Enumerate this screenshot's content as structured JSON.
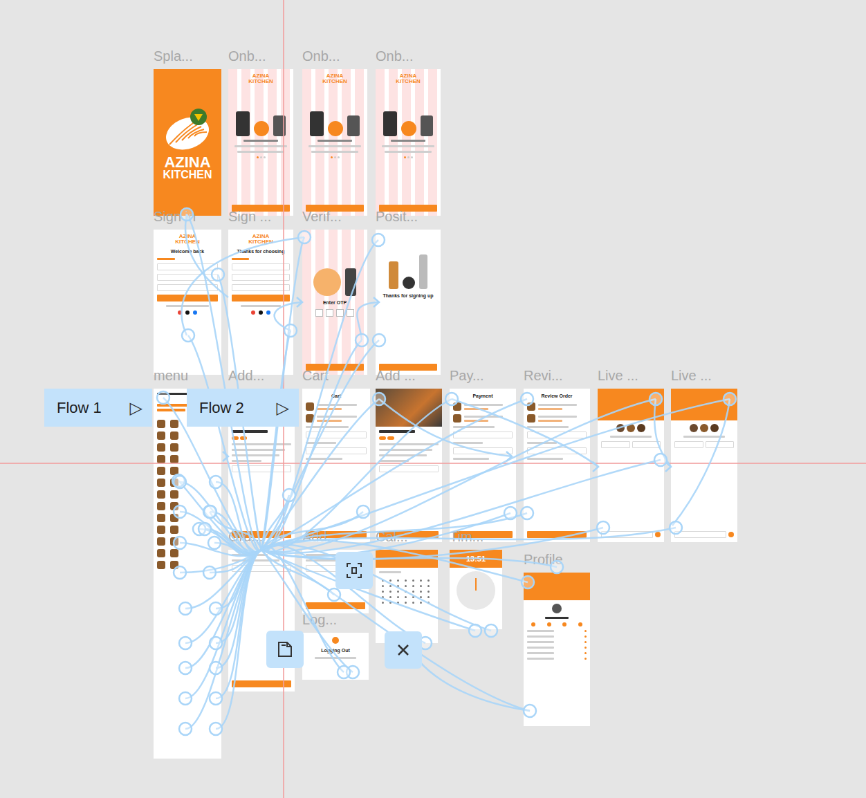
{
  "flows": [
    {
      "label": "Flow 1",
      "icon": "▷"
    },
    {
      "label": "Flow 2",
      "icon": "▷"
    }
  ],
  "frames": [
    {
      "label": "Spla...",
      "kind": "splash",
      "logo": [
        "AZINA",
        "KITCHEN"
      ]
    },
    {
      "label": "Onb...",
      "kind": "onboarding",
      "logo": [
        "AZINA",
        "KITCHEN"
      ]
    },
    {
      "label": "Onb...",
      "kind": "onboarding",
      "logo": [
        "AZINA",
        "KITCHEN"
      ]
    },
    {
      "label": "Onb...",
      "kind": "onboarding",
      "logo": [
        "AZINA",
        "KITCHEN"
      ]
    },
    {
      "label": "Sign in",
      "kind": "form",
      "logo": [
        "AZINA",
        "KITCHEN"
      ],
      "heading": "Welcome back"
    },
    {
      "label": "Sign ...",
      "kind": "form",
      "logo": [
        "AZINA",
        "KITCHEN"
      ],
      "heading": "Thanks for choosing"
    },
    {
      "label": "Verif...",
      "kind": "otp",
      "heading": "Enter OTP"
    },
    {
      "label": "Posit...",
      "kind": "success",
      "heading": "Thanks for signing up"
    },
    {
      "label": "menu",
      "kind": "menu"
    },
    {
      "label": "Add...",
      "kind": "detail"
    },
    {
      "label": "Cart",
      "kind": "list",
      "heading": "Cart"
    },
    {
      "label": "Add ...",
      "kind": "detail"
    },
    {
      "label": "Pay...",
      "kind": "list",
      "heading": "Payment"
    },
    {
      "label": "Revi...",
      "kind": "list",
      "heading": "Review Order"
    },
    {
      "label": "Live ...",
      "kind": "live"
    },
    {
      "label": "Live ...",
      "kind": "live"
    },
    {
      "label": "Ord...",
      "kind": "blank"
    },
    {
      "label": "Add...",
      "kind": "blank"
    },
    {
      "label": "Log...",
      "kind": "logout",
      "heading": "Logging Out"
    },
    {
      "label": "Cal...",
      "kind": "calendar"
    },
    {
      "label": "Tim...",
      "kind": "clock",
      "heading": "13:51"
    },
    {
      "label": "Profile",
      "kind": "profile"
    }
  ]
}
